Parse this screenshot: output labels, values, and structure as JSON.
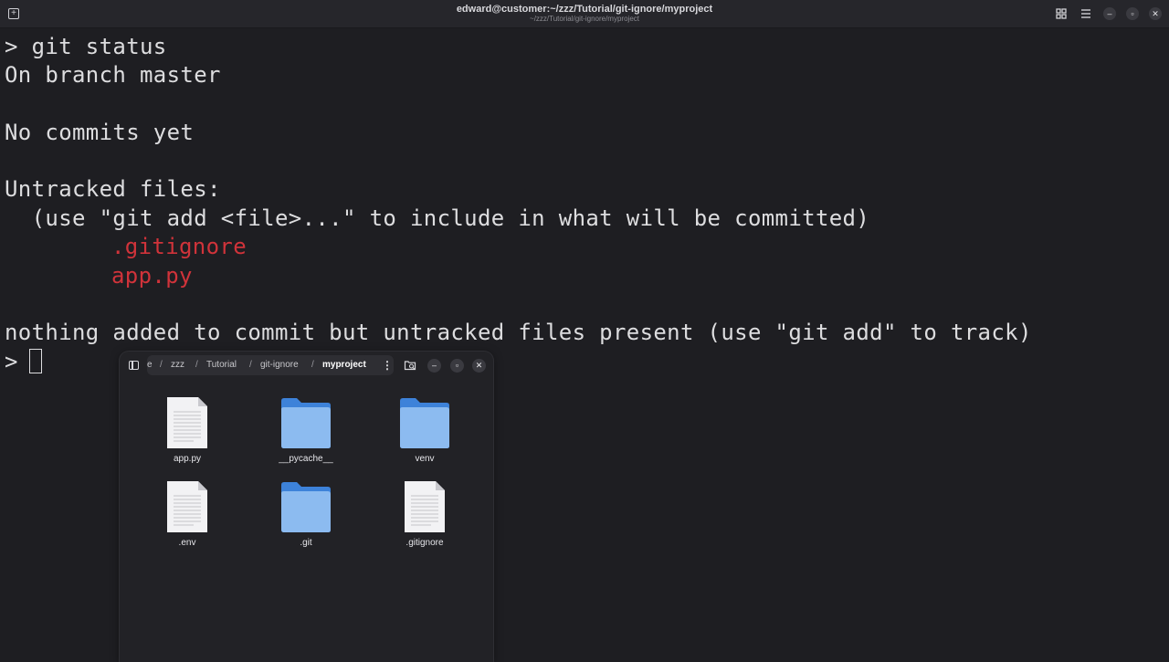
{
  "terminal": {
    "title": "edward@customer:~/zzz/Tutorial/git-ignore/myproject",
    "subtitle": "~/zzz/Tutorial/git-ignore/myproject",
    "lines": {
      "cmd": "> git status",
      "branch": "On branch master",
      "commits": "No commits yet",
      "untracked_header": "Untracked files:",
      "hint": "  (use \"git add <file>...\" to include in what will be committed)",
      "file1": ".gitignore",
      "file2": "app.py",
      "summary": "nothing added to commit but untracked files present (use \"git add\" to track)",
      "prompt": ">"
    }
  },
  "file_manager": {
    "breadcrumb": {
      "parts": [
        "e",
        "zzz",
        "Tutorial",
        "git-ignore",
        "myproject"
      ],
      "separator": "/"
    },
    "files": [
      {
        "name": "app.py",
        "type": "text-file"
      },
      {
        "name": "__pycache__",
        "type": "folder"
      },
      {
        "name": "venv",
        "type": "folder"
      },
      {
        "name": ".env",
        "type": "text-file"
      },
      {
        "name": ".git",
        "type": "folder"
      },
      {
        "name": ".gitignore",
        "type": "text-file"
      }
    ]
  },
  "colors": {
    "background": "#1e1e22",
    "untracked_red": "#d0333a",
    "folder_blue": "#4a8fe0"
  }
}
